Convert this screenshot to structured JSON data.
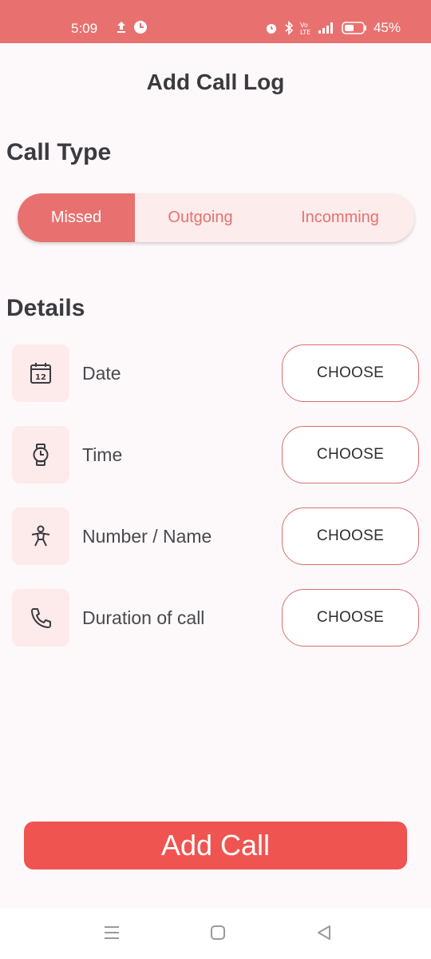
{
  "status_bar": {
    "time": "5:09",
    "battery": "45%",
    "icons": [
      "upload-icon",
      "chat-bubble-icon",
      "alarm-icon",
      "bluetooth-icon",
      "volte-icon",
      "signal-icon",
      "battery-icon"
    ]
  },
  "page": {
    "title": "Add Call Log"
  },
  "call_type": {
    "title": "Call Type",
    "options": [
      "Missed",
      "Outgoing",
      "Incomming"
    ],
    "selected": "Missed"
  },
  "details": {
    "title": "Details",
    "rows": [
      {
        "label": "Date",
        "icon": "calendar-icon",
        "button": "CHOOSE"
      },
      {
        "label": "Time",
        "icon": "watch-icon",
        "button": "CHOOSE"
      },
      {
        "label": "Number / Name",
        "icon": "person-icon",
        "button": "CHOOSE"
      },
      {
        "label": "Duration of call",
        "icon": "phone-icon",
        "button": "CHOOSE"
      }
    ],
    "calendar_day": "12"
  },
  "actions": {
    "add_call_label": "Add Call"
  },
  "colors": {
    "accent": "#e8716f",
    "button_primary": "#ef5450",
    "segment_bg": "#fdecec",
    "icon_box_bg": "#fdeaea"
  },
  "nav_bar": {
    "icons": [
      "menu-icon",
      "home-icon",
      "back-icon"
    ]
  }
}
